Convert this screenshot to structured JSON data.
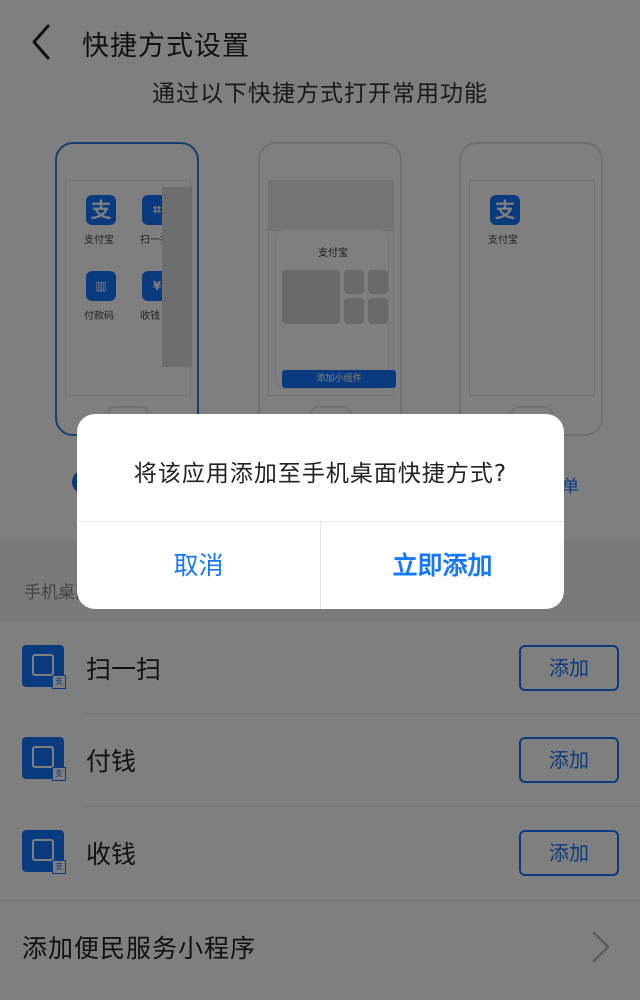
{
  "header": {
    "title": "快捷方式设置",
    "back_icon": "chevron-left-icon"
  },
  "subtitle": "通过以下快捷方式打开常用功能",
  "previews": {
    "phone1": {
      "apps": [
        "支付宝",
        "扫一扫",
        "付款码",
        "收钱"
      ]
    },
    "phone2": {
      "widget_title": "支付宝",
      "widget_button": "添加小组件"
    },
    "phone3": {
      "apps": [
        "支付宝"
      ]
    },
    "partial_text": "单"
  },
  "section_label": "手机桌面",
  "shortcuts": [
    {
      "label": "扫一扫",
      "icon": "scan-icon",
      "button": "添加"
    },
    {
      "label": "付钱",
      "icon": "pay-code-icon",
      "button": "添加"
    },
    {
      "label": "收钱",
      "icon": "receive-money-icon",
      "button": "添加"
    }
  ],
  "bottom_link": {
    "label": "添加便民服务小程序",
    "icon": "chevron-right-icon"
  },
  "dialog": {
    "message": "将该应用添加至手机桌面快捷方式?",
    "cancel": "取消",
    "confirm": "立即添加"
  },
  "colors": {
    "accent": "#1677ff",
    "overlay": "rgba(0,0,0,0.5)",
    "selected_border": "#2f80e0"
  }
}
